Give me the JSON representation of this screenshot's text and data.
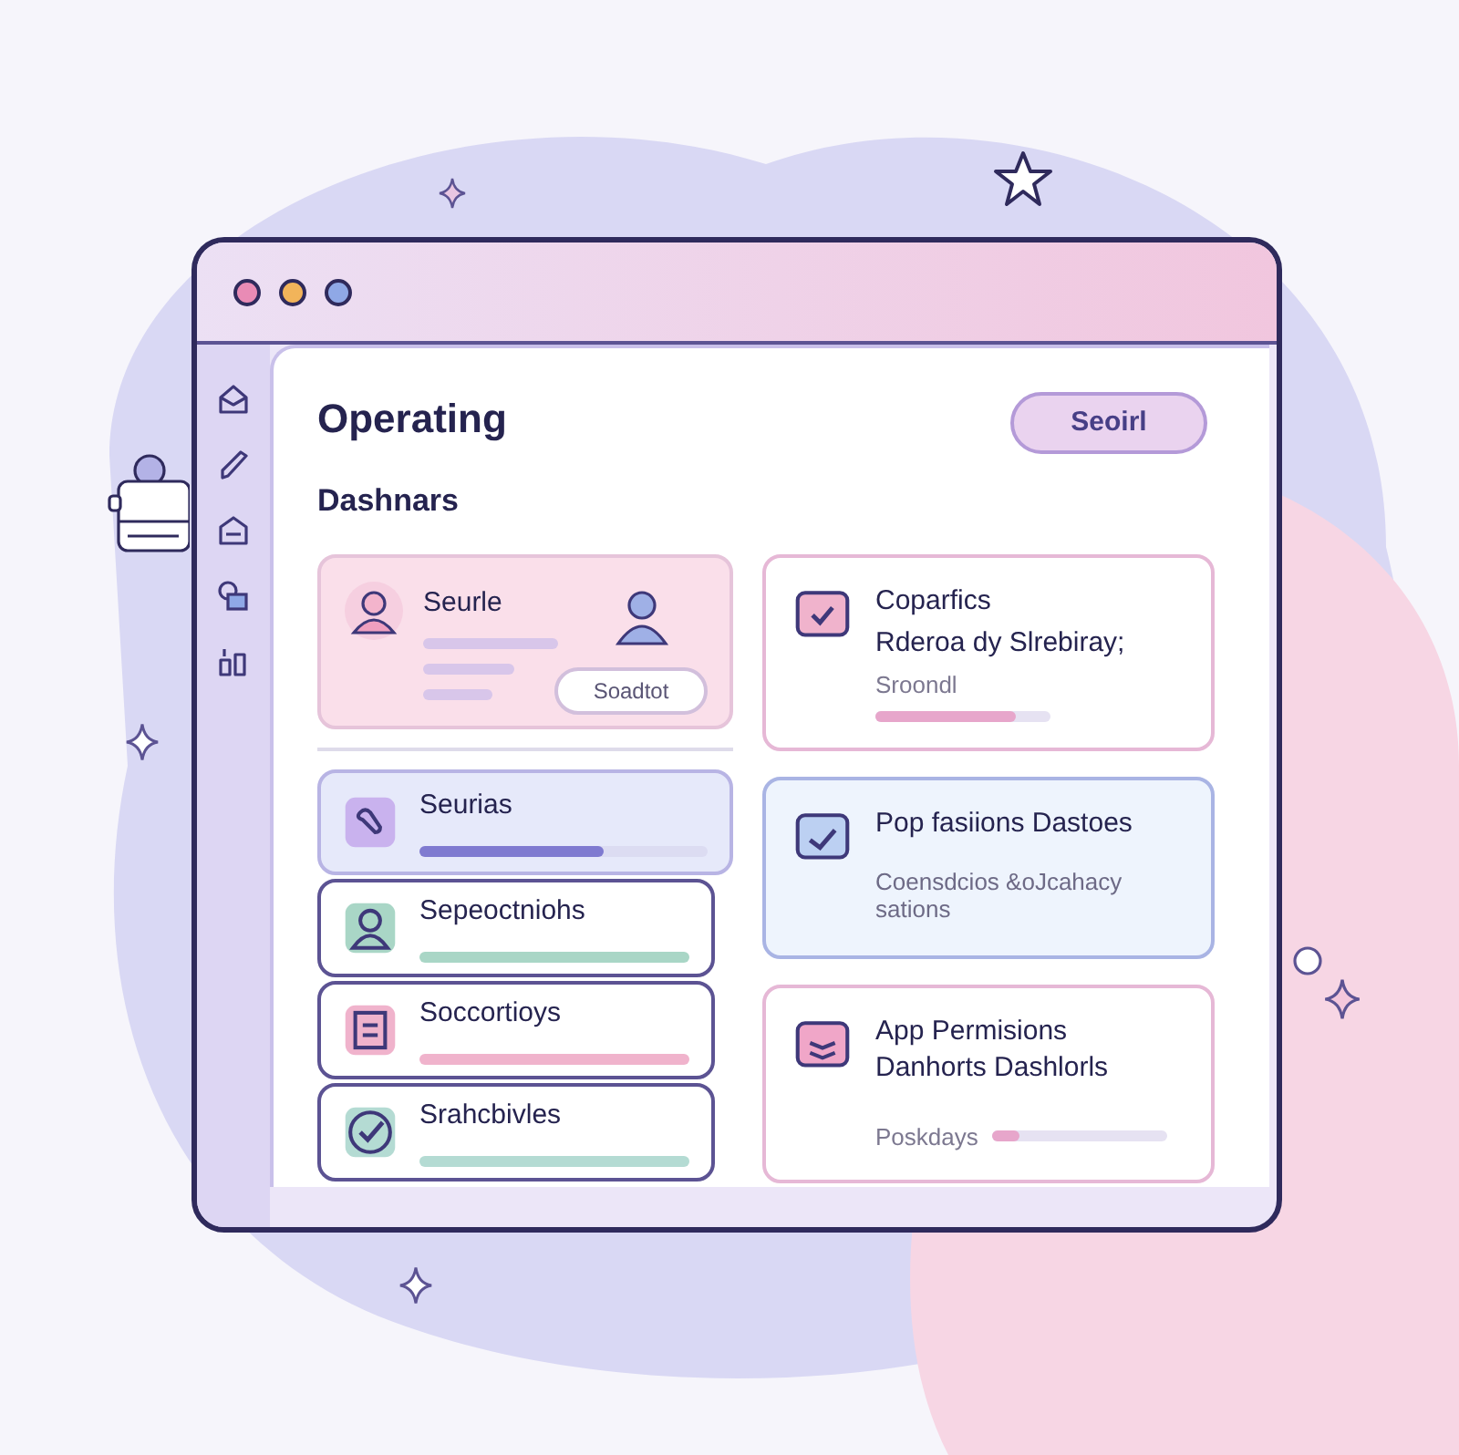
{
  "window": {
    "controls": [
      {
        "color": "#e98bb5"
      },
      {
        "color": "#f2b45a"
      },
      {
        "color": "#8fa8e6"
      }
    ]
  },
  "header": {
    "title": "Operating",
    "subtitle": "Dashnars",
    "button": "Seoirl"
  },
  "profile_card": {
    "title": "Seurle",
    "button": "Soadtot"
  },
  "list": [
    {
      "label": "Seurias",
      "selected": true,
      "color": "#c9b2ee",
      "level": 0.64
    },
    {
      "label": "Sepeoctniohs",
      "selected": false,
      "color": "#a9d6c6"
    },
    {
      "label": "Soccortioys",
      "selected": false,
      "color": "#f0b3cc"
    },
    {
      "label": "Srahcbivles",
      "selected": false,
      "color": "#b4dbd3"
    }
  ],
  "cards": [
    {
      "kind": "progress",
      "title": "Coparfics",
      "text": "Rderoa dy Slrebiray;",
      "label": "Sroondl",
      "level": 0.8
    },
    {
      "kind": "note",
      "title": "Pop fasiions Dastoes",
      "text": "Coensdcios &oJcahacy sations"
    },
    {
      "kind": "progress",
      "title": "App Permisions Danhorts Dashlorls",
      "label": "Poskdays",
      "level": 0.15
    }
  ]
}
